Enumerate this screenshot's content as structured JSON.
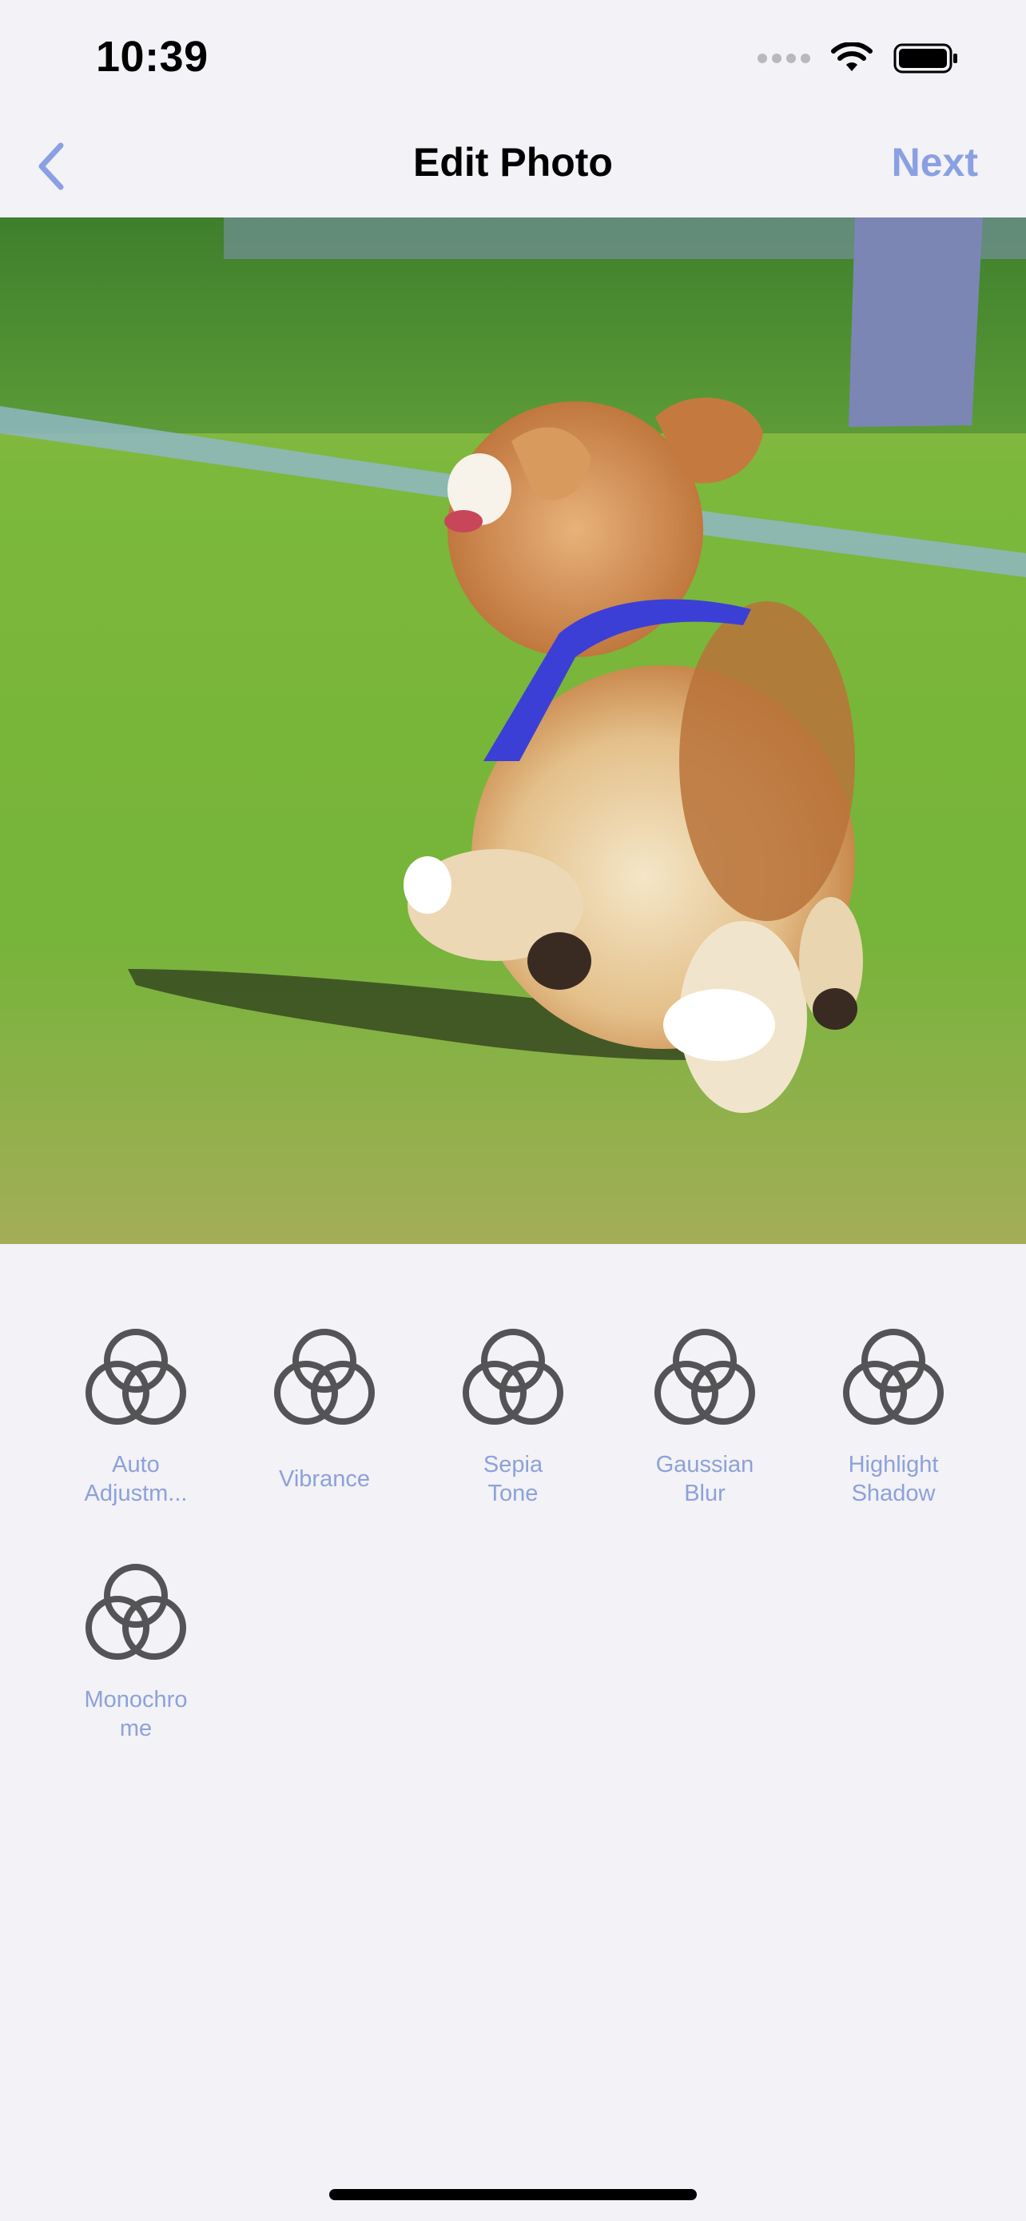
{
  "status_bar": {
    "time": "10:39",
    "icons": [
      "signal-dots-icon",
      "wifi-icon",
      "battery-icon"
    ]
  },
  "nav": {
    "back_icon": "chevron-left-icon",
    "title": "Edit Photo",
    "next_label": "Next",
    "accent_color": "#8aa0e2"
  },
  "photo": {
    "subject": "photo-image"
  },
  "filters": {
    "label_color": "#8ea1d8",
    "icon": "three-circles-icon",
    "items": [
      {
        "label": "Auto\nAdjustm..."
      },
      {
        "label": "Vibrance"
      },
      {
        "label": "Sepia\nTone"
      },
      {
        "label": "Gaussian\nBlur"
      },
      {
        "label": "Highlight\nShadow"
      },
      {
        "label": "Monochro\nme"
      }
    ]
  }
}
